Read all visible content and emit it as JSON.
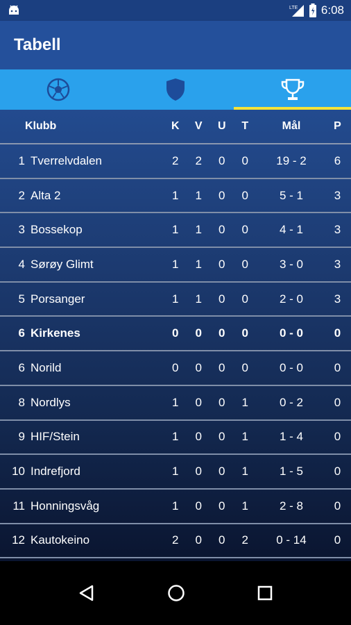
{
  "status_bar": {
    "time": "6:08",
    "network": "LTE"
  },
  "app_bar": {
    "title": "Tabell"
  },
  "tabs": [
    {
      "name": "matches",
      "icon": "soccer-ball-icon",
      "active": false
    },
    {
      "name": "clubs",
      "icon": "shield-icon",
      "active": false
    },
    {
      "name": "table",
      "icon": "trophy-icon",
      "active": true
    }
  ],
  "colors": {
    "accent_indicator": "#f5e33a",
    "tab_bg": "#2aa1ec",
    "app_bar": "#24509b"
  },
  "table": {
    "headers": {
      "club": "Klubb",
      "k": "K",
      "v": "V",
      "u": "U",
      "t": "T",
      "mal": "Mål",
      "p": "P"
    },
    "rows": [
      {
        "pos": "1",
        "club": "Tverrelvdalen",
        "k": "2",
        "v": "2",
        "u": "0",
        "t": "0",
        "mal": "19 - 2",
        "p": "6",
        "bold": false
      },
      {
        "pos": "2",
        "club": "Alta 2",
        "k": "1",
        "v": "1",
        "u": "0",
        "t": "0",
        "mal": "5 - 1",
        "p": "3",
        "bold": false
      },
      {
        "pos": "3",
        "club": "Bossekop",
        "k": "1",
        "v": "1",
        "u": "0",
        "t": "0",
        "mal": "4 - 1",
        "p": "3",
        "bold": false
      },
      {
        "pos": "4",
        "club": "Sørøy Glimt",
        "k": "1",
        "v": "1",
        "u": "0",
        "t": "0",
        "mal": "3 - 0",
        "p": "3",
        "bold": false
      },
      {
        "pos": "5",
        "club": "Porsanger",
        "k": "1",
        "v": "1",
        "u": "0",
        "t": "0",
        "mal": "2 - 0",
        "p": "3",
        "bold": false
      },
      {
        "pos": "6",
        "club": "Kirkenes",
        "k": "0",
        "v": "0",
        "u": "0",
        "t": "0",
        "mal": "0 - 0",
        "p": "0",
        "bold": true
      },
      {
        "pos": "6",
        "club": "Norild",
        "k": "0",
        "v": "0",
        "u": "0",
        "t": "0",
        "mal": "0 - 0",
        "p": "0",
        "bold": false
      },
      {
        "pos": "8",
        "club": "Nordlys",
        "k": "1",
        "v": "0",
        "u": "0",
        "t": "1",
        "mal": "0 - 2",
        "p": "0",
        "bold": false
      },
      {
        "pos": "9",
        "club": "HIF/Stein",
        "k": "1",
        "v": "0",
        "u": "0",
        "t": "1",
        "mal": "1 - 4",
        "p": "0",
        "bold": false
      },
      {
        "pos": "10",
        "club": "Indrefjord",
        "k": "1",
        "v": "0",
        "u": "0",
        "t": "1",
        "mal": "1 - 5",
        "p": "0",
        "bold": false
      },
      {
        "pos": "11",
        "club": "Honningsvåg",
        "k": "1",
        "v": "0",
        "u": "0",
        "t": "1",
        "mal": "2 - 8",
        "p": "0",
        "bold": false
      },
      {
        "pos": "12",
        "club": "Kautokeino",
        "k": "2",
        "v": "0",
        "u": "0",
        "t": "2",
        "mal": "0 - 14",
        "p": "0",
        "bold": false
      }
    ]
  },
  "nav_bar": {
    "back": "back-icon",
    "home": "home-icon",
    "recents": "recents-icon"
  }
}
